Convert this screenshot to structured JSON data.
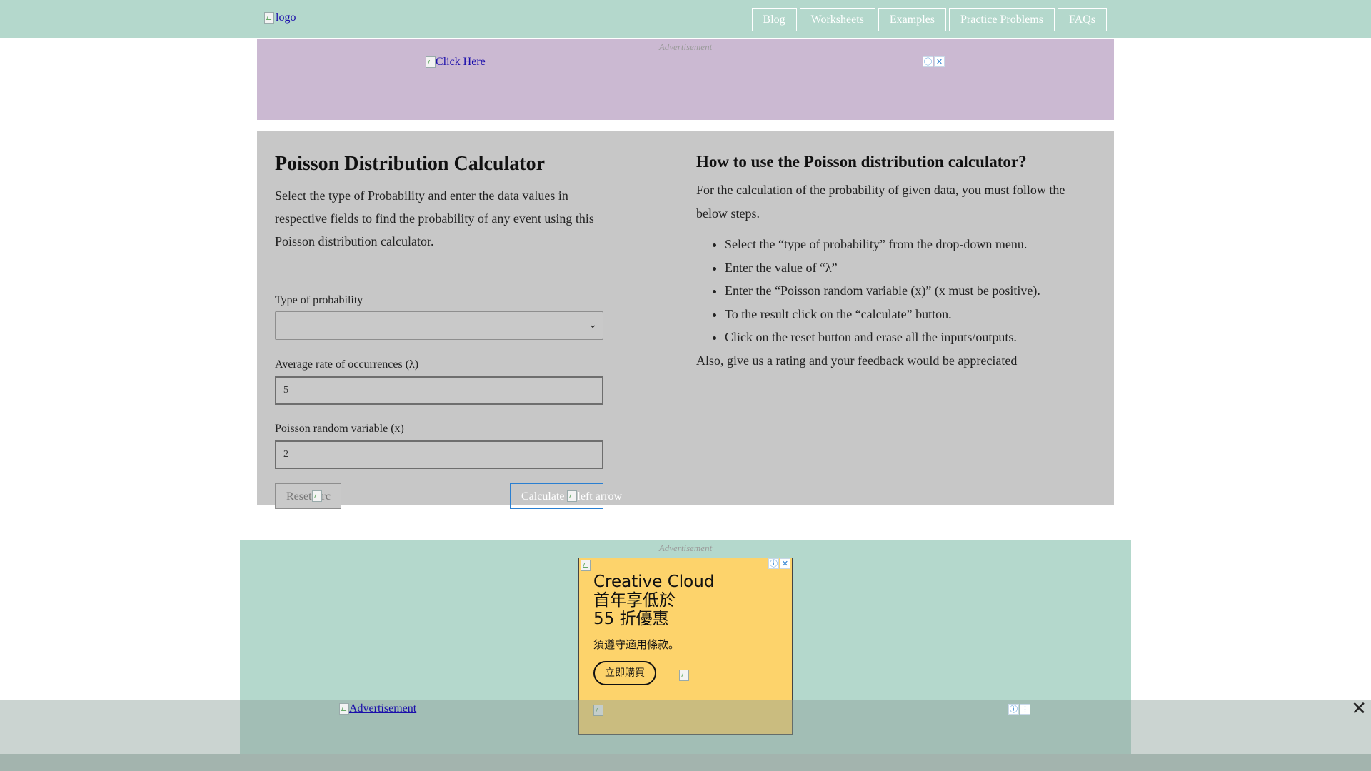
{
  "header": {
    "logo_alt": "logo",
    "nav": [
      "Blog",
      "Worksheets",
      "Examples",
      "Practice Problems",
      "FAQs"
    ]
  },
  "ad_top": {
    "label": "Advertisement",
    "link_text": "Click Here"
  },
  "calculator": {
    "title": "Poisson Distribution Calculator",
    "description": "Select the type of Probability and enter the data values in respective fields to find the probability of any event using this Poisson distribution calculator.",
    "type_label": "Type of probability",
    "type_value": "",
    "lambda_label": "Average rate of occurrences (λ)",
    "lambda_value": "5",
    "x_label": "Poisson random variable (x)",
    "x_value": "2",
    "reset_label": "Reset",
    "reset_icon_alt": "rc",
    "calculate_label": "Calculate",
    "calculate_icon_alt": "left arrow"
  },
  "howto": {
    "title": "How to use the Poisson distribution calculator?",
    "intro": "For the calculation of the probability of given data, you must follow the below steps.",
    "steps": [
      "Select the “type of probability” from the drop-down menu.",
      "Enter the value of “λ”",
      "Enter the “Poisson random variable (x)” (x must be positive).",
      "To the result click on the “calculate” button.",
      "Click on the reset button and erase all the inputs/outputs."
    ],
    "outro": "Also, give us a rating and your feedback would be appreciated"
  },
  "ad_bottom": {
    "label": "Advertisement",
    "line1": "Creative Cloud",
    "line2": "首年享低於",
    "line3": "55 折優惠",
    "note": "須遵守適用條款。",
    "button": "立即購買"
  },
  "sticky_ad": {
    "link_text": "Advertisement",
    "close": "✕"
  }
}
